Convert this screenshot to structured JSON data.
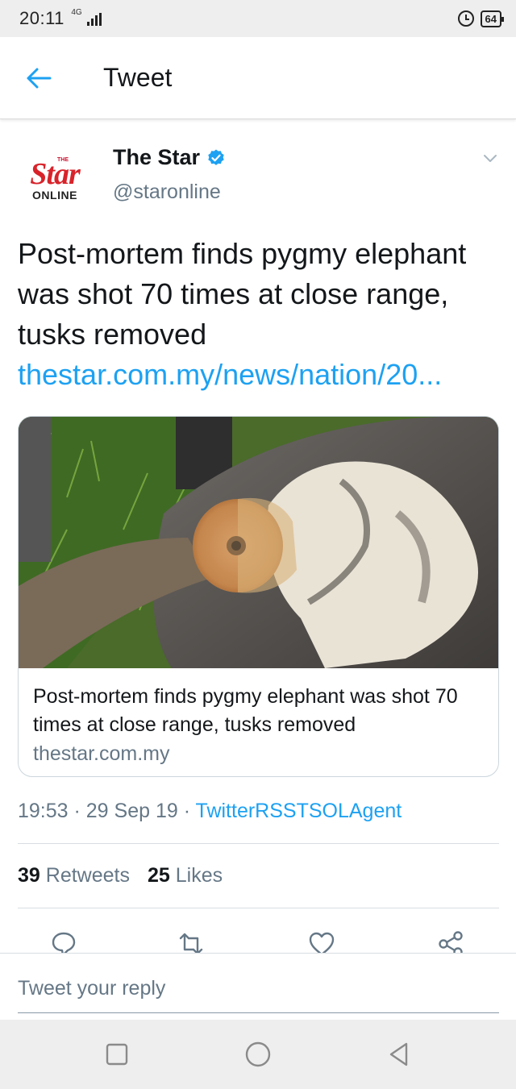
{
  "status_bar": {
    "time": "20:11",
    "network": "4G",
    "battery": "64"
  },
  "app_bar": {
    "title": "Tweet"
  },
  "tweet": {
    "author": {
      "name": "The Star",
      "handle": "@staronline",
      "avatar_text": {
        "top": "THE",
        "main": "Star",
        "bottom": "ONLINE"
      }
    },
    "text": "Post-mortem finds pygmy elephant was shot 70 times at close range, tusks removed",
    "link": "thestar.com.my/news/nation/20...",
    "card": {
      "title": "Post-mortem finds pygmy elephant was shot 70 times at close range, tusks removed",
      "domain": "thestar.com.my"
    },
    "meta": {
      "time": "19:53",
      "sep1": " · ",
      "date": "29 Sep 19",
      "sep2": " · ",
      "source": "TwitterRSSTSOLAgent"
    },
    "stats": {
      "retweets_count": "39",
      "retweets_label": "Retweets",
      "likes_count": "25",
      "likes_label": "Likes"
    }
  },
  "reply": {
    "placeholder": "Tweet your reply"
  },
  "colors": {
    "accent": "#1da1f2",
    "secondary_text": "#657786",
    "brand_red": "#d8232a"
  }
}
